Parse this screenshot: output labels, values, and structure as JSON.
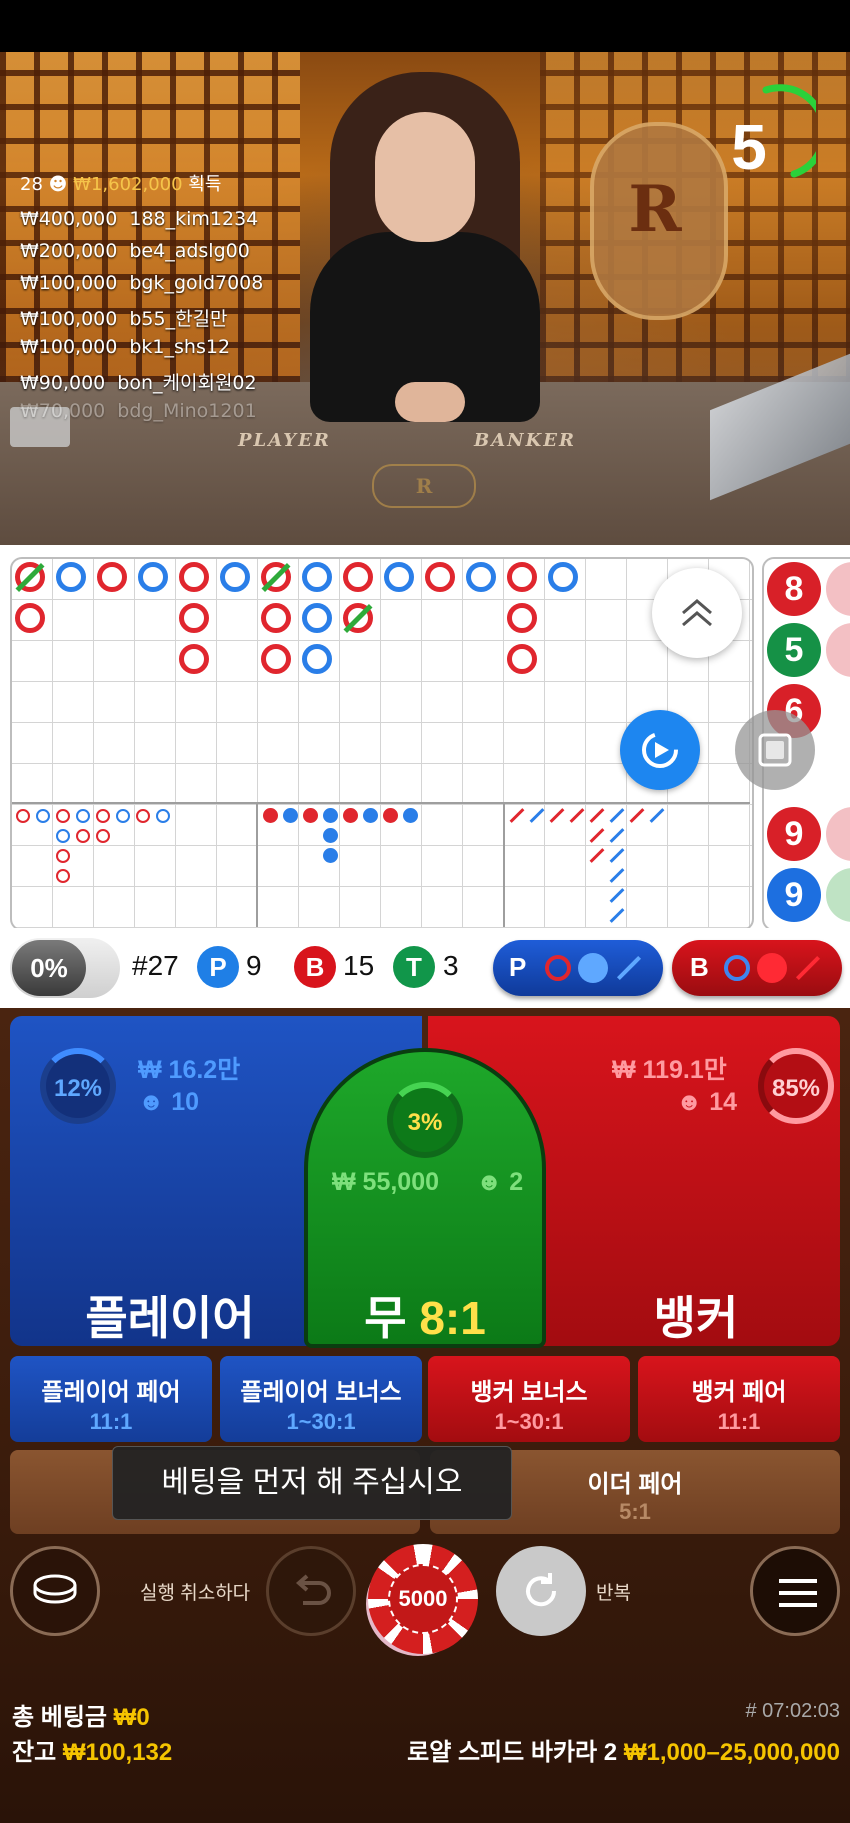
{
  "stream": {
    "timer": "5",
    "winners_count": "28",
    "winners_total": "₩1,602,000",
    "winners_suffix": "획득",
    "winners": [
      {
        "amount": "₩400,000",
        "name": "188_kim1234"
      },
      {
        "amount": "₩200,000",
        "name": "be4_adslg00"
      },
      {
        "amount": "₩100,000",
        "name": "bgk_gold7008"
      },
      {
        "amount": "₩100,000",
        "name": "b55_한길만"
      },
      {
        "amount": "₩100,000",
        "name": "bk1_shs12"
      },
      {
        "amount": "₩90,000",
        "name": "bon_케이회원02"
      },
      {
        "amount": "₩70,000",
        "name": "bdg_Mino1201"
      }
    ],
    "felt_player": "PLAYER",
    "felt_banker": "BANKER",
    "emblem_letter": "R",
    "logo_letter": "R"
  },
  "roadmap": {
    "bead_numbers": [
      "8",
      "5",
      "6",
      "9",
      "9"
    ]
  },
  "stats": {
    "percent": "0%",
    "round": "#27",
    "player_icon": "P",
    "player_count": "9",
    "banker_icon": "B",
    "banker_count": "15",
    "tie_icon": "T",
    "tie_count": "3",
    "ask_player": "P",
    "ask_banker": "B"
  },
  "bets": {
    "player": {
      "title": "플레이어",
      "percent": "12%",
      "amount": "₩ 16.2만",
      "users": "10"
    },
    "tie": {
      "title": "무",
      "odds": "8:1",
      "percent": "3%",
      "amount": "₩ 55,000",
      "users": "2"
    },
    "banker": {
      "title": "뱅커",
      "percent": "85%",
      "amount": "₩ 119.1만",
      "users": "14"
    },
    "side": [
      {
        "name": "플레이어 페어",
        "odds": "11:1"
      },
      {
        "name": "플레이어 보너스",
        "odds": "1~30:1"
      },
      {
        "name": "뱅커 보너스",
        "odds": "1~30:1"
      },
      {
        "name": "뱅커 페어",
        "odds": "11:1"
      }
    ],
    "either_pair": {
      "name": "이더 페어",
      "odds": "5:1"
    },
    "toast": "베팅을 먼저 해 주십시오"
  },
  "controls": {
    "undo_label": "실행 취소하다",
    "chip_value": "5000",
    "repeat_label": "반복"
  },
  "footer": {
    "total_bet_label": "총 베팅금",
    "total_bet": "₩0",
    "balance_label": "잔고",
    "balance": "₩100,132",
    "round_id": "# 07:02:03",
    "table_name": "로얄 스피드 바카라 2",
    "limits": "₩1,000–25,000,000"
  },
  "colors": {
    "player": "#1f54c4",
    "banker": "#d8141c",
    "tie": "#1ea82a",
    "gold": "#f5c400"
  }
}
